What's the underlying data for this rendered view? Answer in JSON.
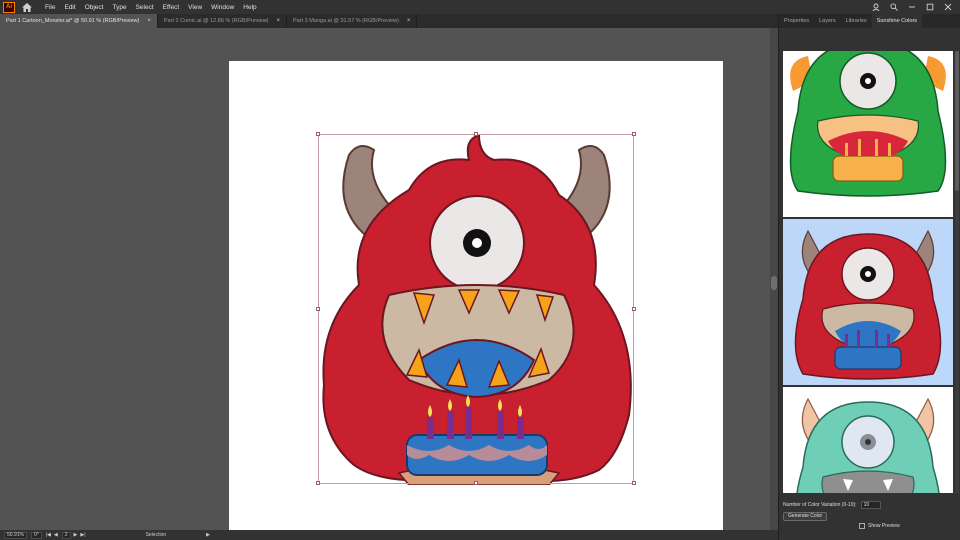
{
  "app": {
    "logo_text": "Ai",
    "menu": [
      "File",
      "Edit",
      "Object",
      "Type",
      "Select",
      "Effect",
      "View",
      "Window",
      "Help"
    ]
  },
  "tabs": [
    {
      "label": "Part 1 Cartoon_Monster.ai* @ 50.91 % (RGB/Preview)",
      "active": true
    },
    {
      "label": "Part 2 Comic.ai @ 12.86 % (RGB/Preview)",
      "active": false
    },
    {
      "label": "Part 3 Manga.ai @ 31.57 % (RGB/Preview)",
      "active": false
    }
  ],
  "statusbar": {
    "zoom": "50.91%",
    "rotation": "0°",
    "artboard": "2",
    "tool": "Selection"
  },
  "panel": {
    "tabs": [
      "Properties",
      "Layers",
      "Libraries",
      "Sunshine Colors"
    ],
    "active_tab": "Sunshine Colors",
    "variation_label": "Number of Color Variation (0-10):",
    "variation_value": "10",
    "generate_label": "Generate Color",
    "show_preview_label": "Show Preview"
  },
  "colors": {
    "monster_fur": "#c8202f",
    "horn": "#9c847a",
    "mouth": "#ccb9a3",
    "teeth": "#f6a31a",
    "tongue": "#2e76c4",
    "variant_1_fur": "#27a844",
    "variant_2_fur": "#c8202f",
    "variant_2_bg": "#bcd7f7",
    "variant_3_fur": "#6fcfb6"
  }
}
